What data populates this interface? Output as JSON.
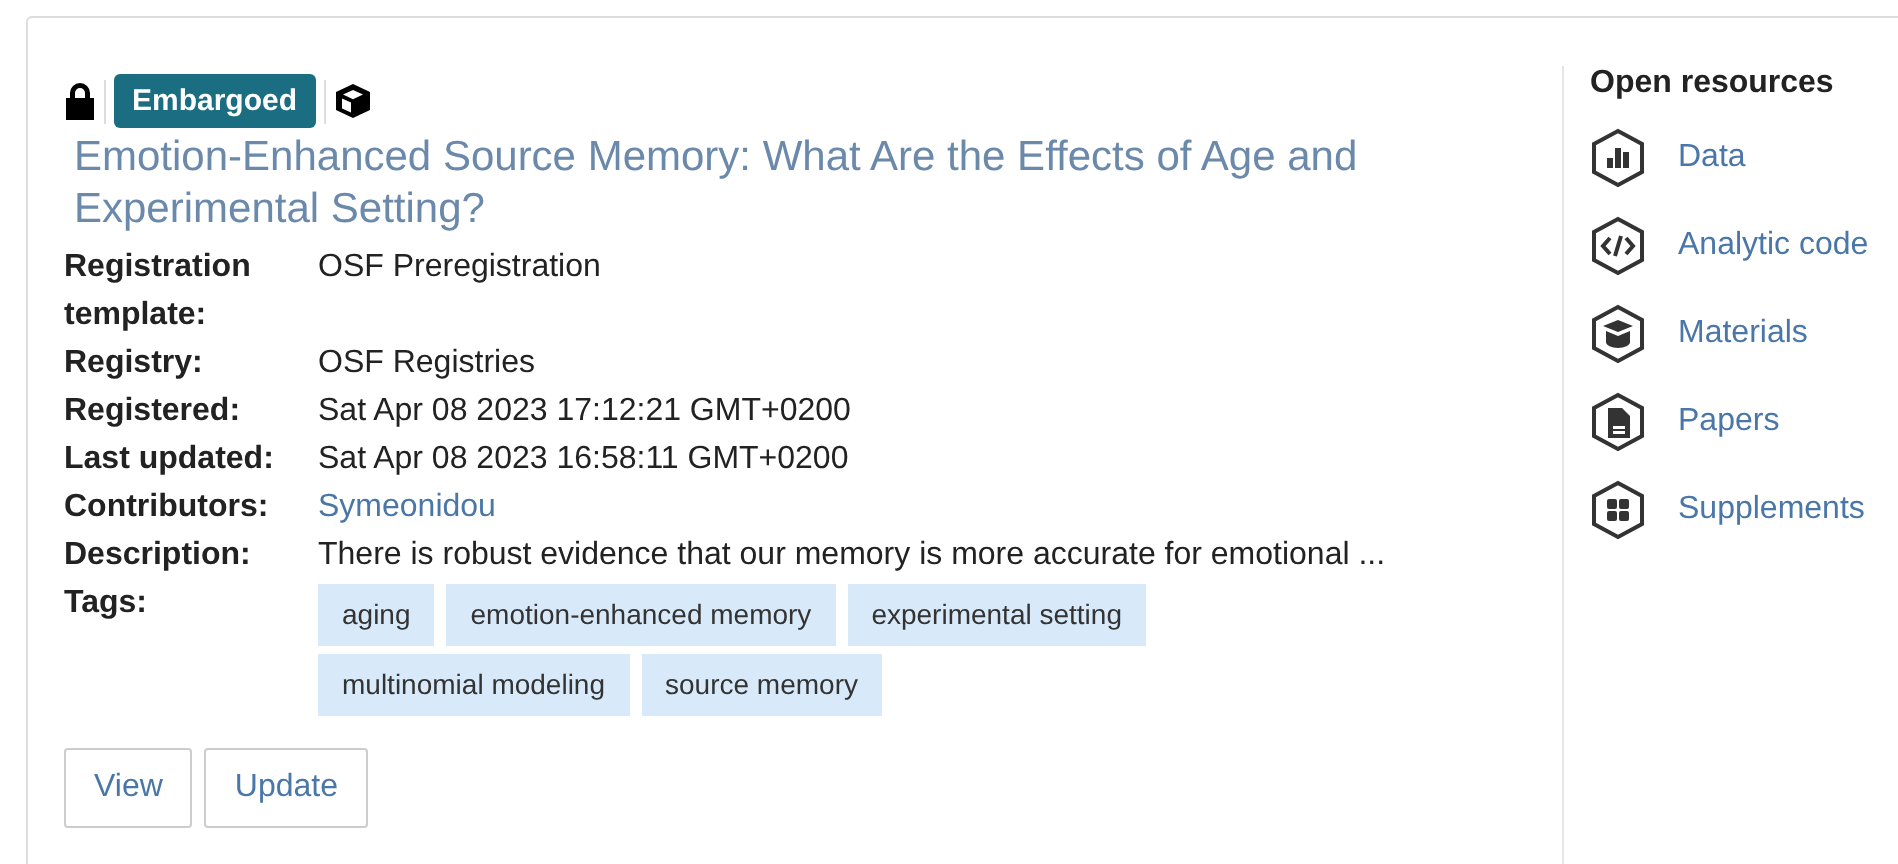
{
  "status_badge": "Embargoed",
  "title": "Emotion-Enhanced Source Memory: What Are the Effects of Age and Experimental Setting?",
  "fields": [
    {
      "label": "Registration template:",
      "value": "OSF Preregistration",
      "kind": "text"
    },
    {
      "label": "Registry:",
      "value": "OSF Registries",
      "kind": "text"
    },
    {
      "label": "Registered:",
      "value": "Sat Apr 08 2023 17:12:21 GMT+0200",
      "kind": "text"
    },
    {
      "label": "Last updated:",
      "value": "Sat Apr 08 2023 16:58:11 GMT+0200",
      "kind": "text"
    },
    {
      "label": "Contributors:",
      "value": "Symeonidou",
      "kind": "link"
    },
    {
      "label": "Description:",
      "value": "There is robust evidence that our memory is more accurate for emotional ...",
      "kind": "text"
    }
  ],
  "tags_label": "Tags:",
  "tags": [
    "aging",
    "emotion-enhanced memory",
    "experimental setting",
    "multinomial modeling",
    "source memory"
  ],
  "buttons": [
    "View",
    "Update"
  ],
  "open_resources": {
    "title": "Open resources",
    "items": [
      {
        "label": "Data",
        "kind": "data"
      },
      {
        "label": "Analytic code",
        "kind": "code"
      },
      {
        "label": "Materials",
        "kind": "materials"
      },
      {
        "label": "Papers",
        "kind": "papers"
      },
      {
        "label": "Supplements",
        "kind": "supplements"
      }
    ]
  }
}
